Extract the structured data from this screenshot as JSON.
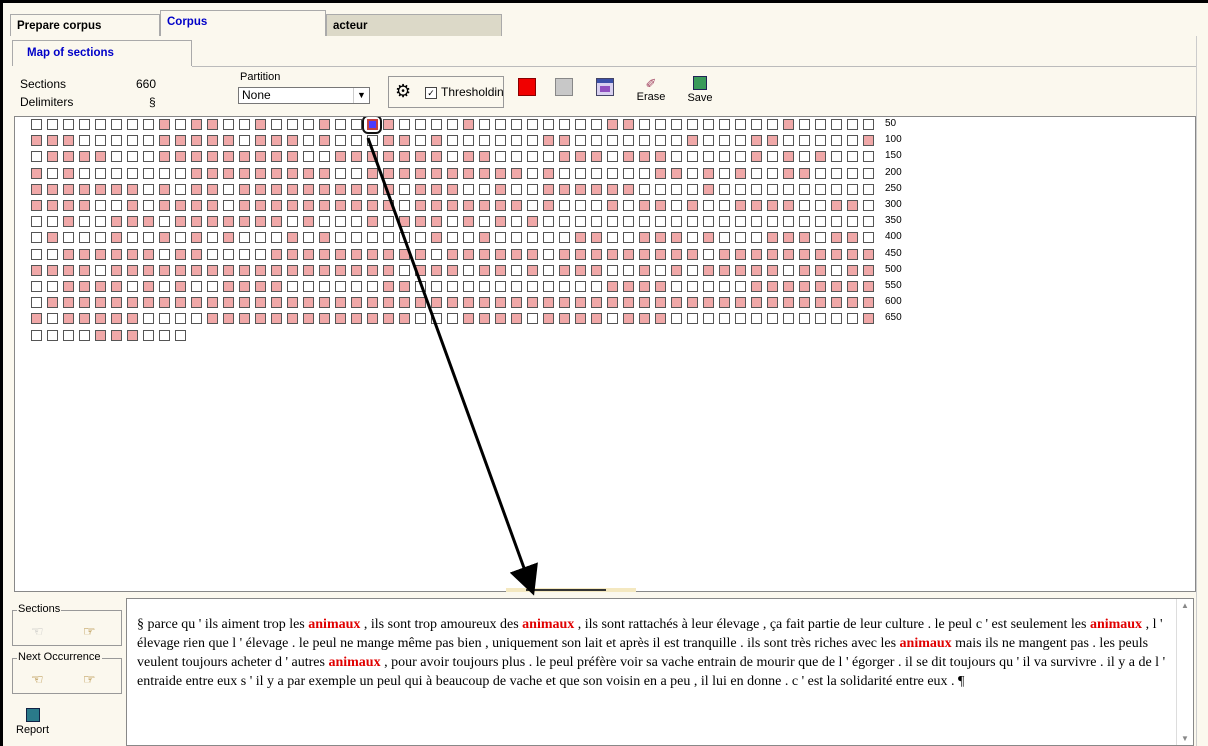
{
  "tabs_top": [
    "Prepare corpus",
    "Corpus",
    "acteur"
  ],
  "subtab": "Map  of sections",
  "info": {
    "sections_label": "Sections",
    "sections_value": "660",
    "delimiters_label": "Delimiters",
    "delimiters_value": "§"
  },
  "partition": {
    "label": "Partition",
    "value": "None"
  },
  "thresholding": {
    "label": "Thresholding",
    "checked": true
  },
  "toolbar": {
    "color_selected": "#f00000",
    "color_unselected": "#c8c8c8",
    "erase_label": "Erase",
    "save_label": "Save"
  },
  "map": {
    "row_labels": [
      "50",
      "100",
      "150",
      "200",
      "250",
      "300",
      "350",
      "400",
      "450",
      "500",
      "550",
      "600",
      "650"
    ],
    "rows": [
      "00000000101100100010011000010000000011000000000100000",
      "11100000111110111010001101000000110000000100011000001",
      "01111000111111111001111111011000011101110000010101000",
      "10100000001111111110011111111110100000011010100110000",
      "11111110101101111111111011100100111111000010000000000",
      "11110010111101111111111011111110100010110100111100110",
      "00100111011111110100010111010101000000000000000000000",
      "01000100101010001010000001001000001100111010001110110",
      "00111111011000011111111110111111011111111101111111111",
      "11110111111111111111111011101101011100101011111011011",
      "00111101010011110000001100000000000011110000011111111",
      "01111111111111111111111111111111111111111111111111111",
      "10111110000111111111111100011110111101110000000000001",
      "0000111000"
    ],
    "selected_index": 21
  },
  "sections_group": "Sections",
  "next_group": "Next Occurrence",
  "report_label": "Report",
  "text": {
    "segments": [
      {
        "t": "§ parce qu ' ils aiment trop les "
      },
      {
        "t": "animaux",
        "hl": true
      },
      {
        "t": " , ils sont trop amoureux des "
      },
      {
        "t": "animaux",
        "hl": true
      },
      {
        "t": " , ils sont rattachés à leur élevage , ça fait partie de leur culture . le peul c ' est seulement les "
      },
      {
        "t": "animaux",
        "hl": true
      },
      {
        "t": " , l ' élevage rien que l ' élevage . le peul ne mange même pas bien , uniquement son lait et après il est tranquille . ils sont très riches avec les "
      },
      {
        "t": "animaux",
        "hl": true
      },
      {
        "t": " mais ils ne mangent pas . les peuls veulent toujours acheter d ' autres "
      },
      {
        "t": "animaux",
        "hl": true
      },
      {
        "t": " , pour avoir toujours plus . le peul préfère voir sa vache entrain de mourir que de l ' égorger . il se dit toujours qu ' il va survivre . il y a de l ' entraide entre eux s ' il y a par exemple un peul qui à beaucoup de vache et que son voisin en a peu , il lui en donne . c ' est la solidarité entre eux . ¶"
      }
    ]
  }
}
